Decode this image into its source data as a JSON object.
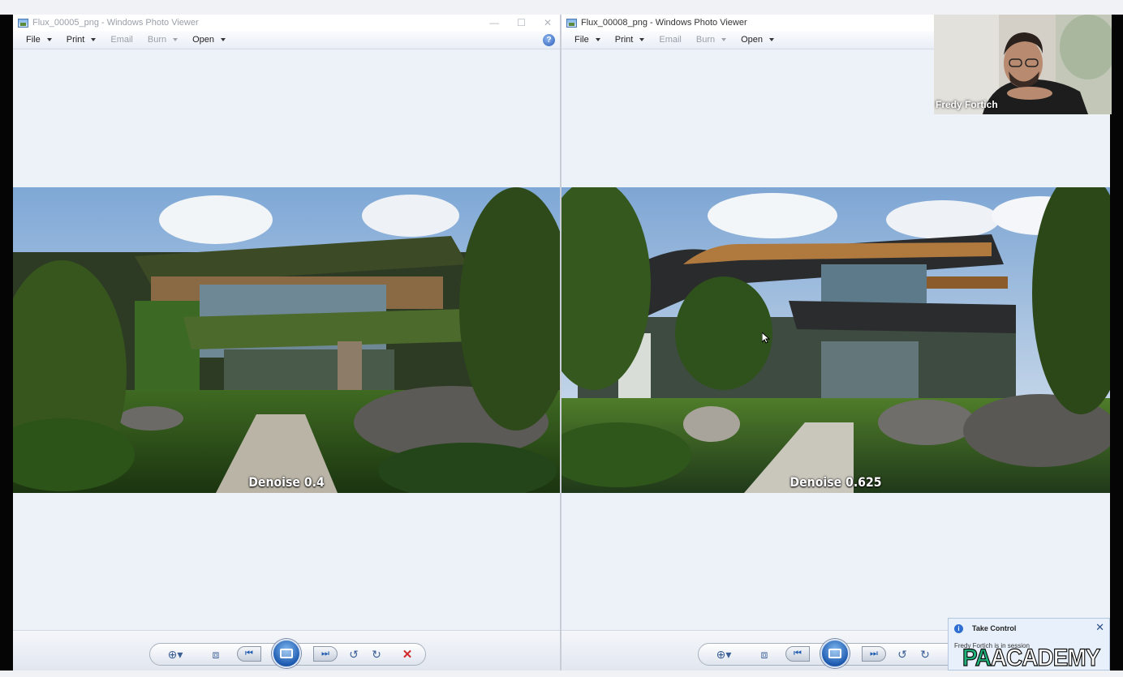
{
  "left_viewer": {
    "title": "Flux_00005_png - Windows Photo Viewer",
    "menu": [
      {
        "label": "File",
        "enabled": true
      },
      {
        "label": "Print",
        "enabled": true
      },
      {
        "label": "Email",
        "enabled": false
      },
      {
        "label": "Burn",
        "enabled": false
      },
      {
        "label": "Open",
        "enabled": true
      }
    ],
    "caption": "Denoise 0.4"
  },
  "right_viewer": {
    "title": "Flux_00008_png - Windows Photo Viewer",
    "menu": [
      {
        "label": "File",
        "enabled": true
      },
      {
        "label": "Print",
        "enabled": true
      },
      {
        "label": "Email",
        "enabled": false
      },
      {
        "label": "Burn",
        "enabled": false
      },
      {
        "label": "Open",
        "enabled": true
      }
    ],
    "caption": "Denoise 0.625"
  },
  "icons": {
    "window_minimize": "minimize-icon",
    "window_maximize": "maximize-icon",
    "window_close": "close-icon",
    "help": "help-icon",
    "zoom": "zoom-icon",
    "fit": "fit-window-icon",
    "previous": "previous-icon",
    "slideshow": "slideshow-icon",
    "next": "next-icon",
    "rotate_ccw": "rotate-counterclockwise-icon",
    "rotate_cw": "rotate-clockwise-icon",
    "delete": "delete-icon"
  },
  "video_call": {
    "participant_name": "Fredy Fortich"
  },
  "notification": {
    "title": "Take Control",
    "body": "Fredy Fortich is in session"
  },
  "watermark": {
    "part1": "PA",
    "part2": "ACADEMY"
  },
  "colors": {
    "window_bg": "#edf1f8",
    "accent_blue": "#1e5bb0",
    "delete_red": "#d12a2a",
    "logo_green": "#1fb07a"
  }
}
